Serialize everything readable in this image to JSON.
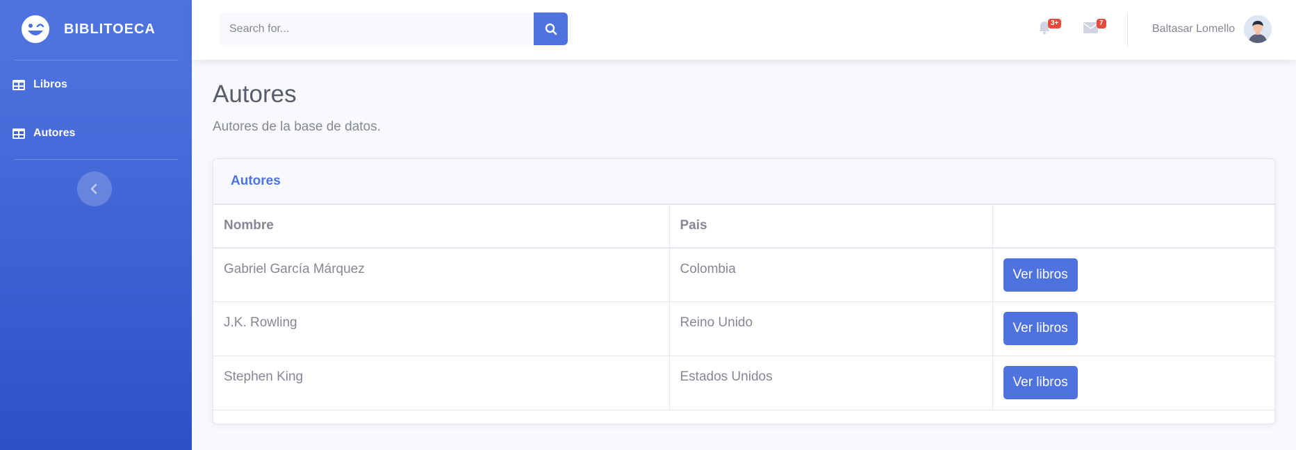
{
  "brand": {
    "name": "BIBLITOECA"
  },
  "sidebar": {
    "items": [
      {
        "label": "Libros",
        "icon": "table-icon"
      },
      {
        "label": "Autores",
        "icon": "table-icon"
      }
    ],
    "toggle_icon": "chevron-left-icon"
  },
  "topbar": {
    "search_placeholder": "Search for...",
    "search_icon": "search-icon",
    "alerts": {
      "icon": "bell-icon",
      "count": "3+"
    },
    "messages": {
      "icon": "envelope-icon",
      "count": "7"
    },
    "user_name": "Baltasar Lomello"
  },
  "page": {
    "title": "Autores",
    "subtitle": "Autores de la base de datos."
  },
  "card": {
    "title": "Autores",
    "columns": [
      "Nombre",
      "Pais",
      ""
    ],
    "rows": [
      {
        "nombre": "Gabriel García Márquez",
        "pais": "Colombia",
        "action": "Ver libros"
      },
      {
        "nombre": "J.K. Rowling",
        "pais": "Reino Unido",
        "action": "Ver libros"
      },
      {
        "nombre": "Stephen King",
        "pais": "Estados Unidos",
        "action": "Ver libros"
      }
    ]
  },
  "colors": {
    "primary": "#4e73df",
    "danger": "#e74a3b",
    "text_muted": "#858796"
  }
}
